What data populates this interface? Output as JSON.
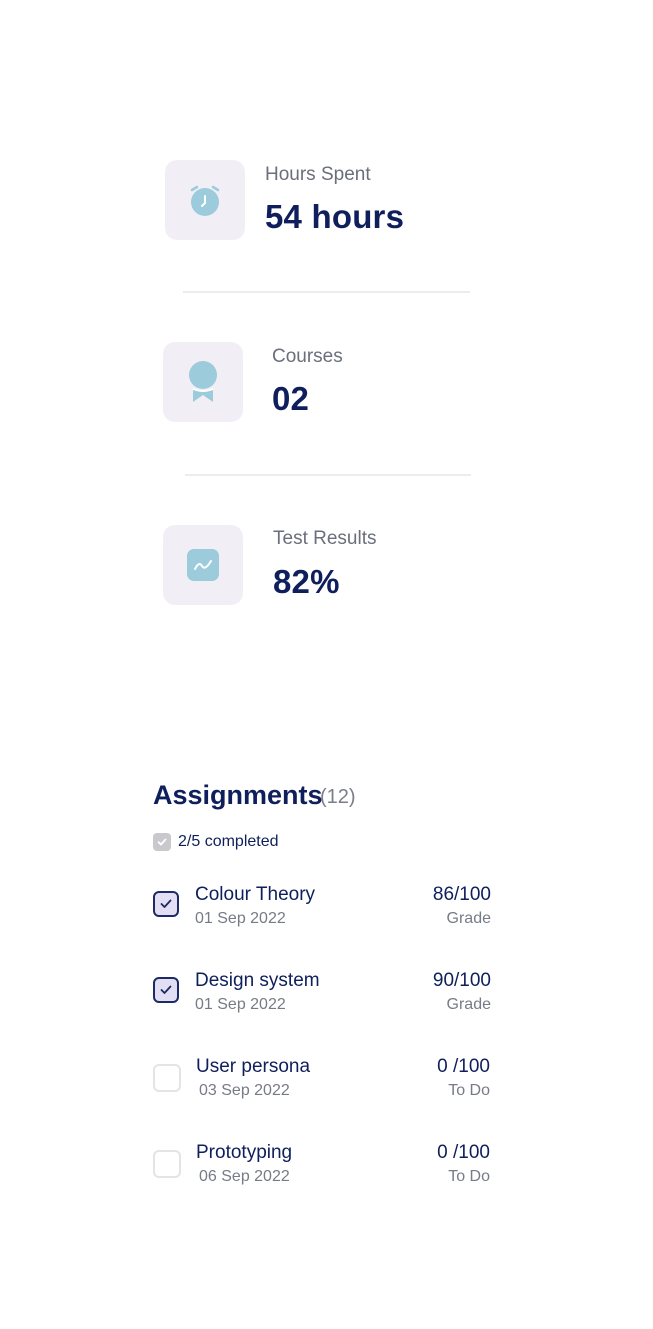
{
  "stats": [
    {
      "label": "Hours Spent",
      "value": "54 hours",
      "icon": "alarm-clock-icon"
    },
    {
      "label": "Courses",
      "value": "02",
      "icon": "award-ribbon-icon"
    },
    {
      "label": "Test Results",
      "value": "82%",
      "icon": "chart-line-icon"
    }
  ],
  "assignments": {
    "title": "Assignments",
    "count": "(12)",
    "progress_text": "2/5 completed",
    "progress_fraction": 0.4,
    "items": [
      {
        "name": "Colour Theory",
        "date": "01 Sep 2022",
        "score": "86/100",
        "status": "Grade",
        "completed": true
      },
      {
        "name": "Design system",
        "date": "01 Sep 2022",
        "score": "90/100",
        "status": "Grade",
        "completed": true
      },
      {
        "name": "User persona",
        "date": "03 Sep 2022",
        "score": "0 /100",
        "status": "To Do",
        "completed": false
      },
      {
        "name": "Prototyping",
        "date": "06 Sep 2022",
        "score": "0 /100",
        "status": "To Do",
        "completed": false
      }
    ]
  },
  "colors": {
    "primary_text": "#0f1f5c",
    "icon_accent": "#9ccbdc",
    "icon_background": "#f1eff5",
    "muted_text": "#6b6f7b",
    "checkbox_checked_fill": "#e2def3"
  }
}
